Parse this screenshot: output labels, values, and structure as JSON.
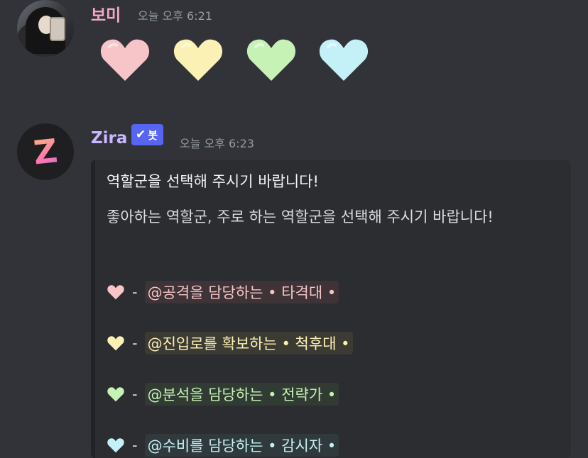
{
  "messages": [
    {
      "author": "보미",
      "author_color": "#f3a6c8",
      "timestamp": "오늘 오후 6:21",
      "hearts": [
        {
          "icon": "pink-heart-icon",
          "color": "#f7c5c8"
        },
        {
          "icon": "yellow-heart-icon",
          "color": "#fbf1b5"
        },
        {
          "icon": "green-heart-icon",
          "color": "#c6f2b5"
        },
        {
          "icon": "blue-heart-icon",
          "color": "#c4f1f7"
        }
      ]
    },
    {
      "author": "Zira",
      "author_color": "#c9b7ff",
      "bot_badge": "봇",
      "timestamp": "오늘 오후 6:23",
      "avatar_letter": "Z",
      "embed": {
        "title": "역할군을 선택해 주시기 바랍니다!",
        "description": "좋아하는 역할군, 주로 하는 역할군을 선택해 주시기 바랍니다!",
        "roles": [
          {
            "icon": "pink-heart-icon",
            "color": "#f7c5c8",
            "dash": "-",
            "mention": "@공격을 담당하는 • 타격대 •",
            "mention_color": "#f7c5c8",
            "mention_bg": "#3e3336"
          },
          {
            "icon": "yellow-heart-icon",
            "color": "#fbf1b5",
            "dash": "-",
            "mention": "@진입로를 확보하는 • 척후대 •",
            "mention_color": "#fbf1b5",
            "mention_bg": "#3c3b33"
          },
          {
            "icon": "green-heart-icon",
            "color": "#c6f2b5",
            "dash": "-",
            "mention": "@분석을 담당하는 • 전략가 •",
            "mention_color": "#c6f2b5",
            "mention_bg": "#313b33"
          },
          {
            "icon": "blue-heart-icon",
            "color": "#c4f1f7",
            "dash": "-",
            "mention": "@수비를 담당하는 • 감시자 •",
            "mention_color": "#c4f1f7",
            "mention_bg": "#303a3d"
          }
        ]
      }
    }
  ]
}
